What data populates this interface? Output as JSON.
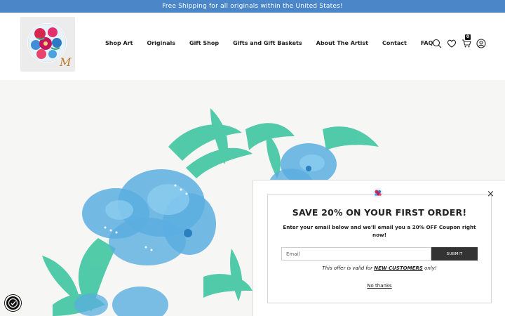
{
  "announcement": "Free Shipping for all originals within the United States!",
  "logo": {
    "letter": "M"
  },
  "nav": [
    "Shop Art",
    "Originals",
    "Gift Shop",
    "Gifts and Gift Baskets",
    "About The Artist",
    "Contact",
    "FAQ"
  ],
  "header_icons": {
    "icons": [
      "search-icon",
      "heart-icon",
      "cart-icon",
      "account-icon"
    ],
    "cart_count": "0"
  },
  "popup": {
    "title": "SAVE 20% ON YOUR FIRST ORDER!",
    "subtitle": "Enter your email below and we'll email you a 20% OFF Coupon right now!",
    "email_placeholder": "Email",
    "submit_label": "SUBMIT",
    "valid_prefix": "This offer is valid for",
    "valid_highlight": "NEW CUSTOMERS",
    "valid_suffix": "only!",
    "no_thanks": "No thanks",
    "close_label": "×"
  },
  "colors": {
    "announcement_bg": "#4a86c8",
    "submit_bg": "#333333",
    "flower_blue": "#4fa8dd",
    "leaf_teal": "#3fc6a0"
  }
}
